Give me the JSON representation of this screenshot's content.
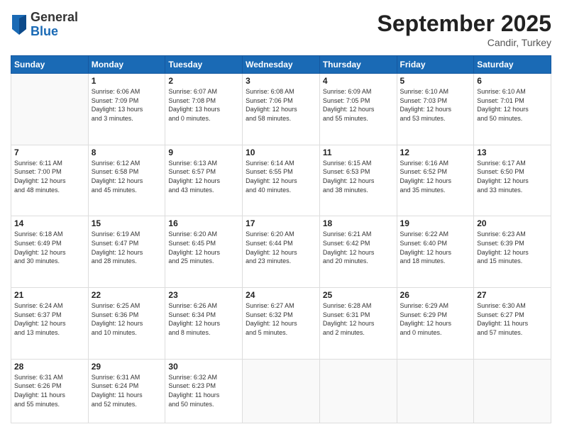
{
  "header": {
    "logo_general": "General",
    "logo_blue": "Blue",
    "month_title": "September 2025",
    "location": "Candir, Turkey"
  },
  "weekdays": [
    "Sunday",
    "Monday",
    "Tuesday",
    "Wednesday",
    "Thursday",
    "Friday",
    "Saturday"
  ],
  "weeks": [
    [
      {
        "day": "",
        "info": ""
      },
      {
        "day": "1",
        "info": "Sunrise: 6:06 AM\nSunset: 7:09 PM\nDaylight: 13 hours\nand 3 minutes."
      },
      {
        "day": "2",
        "info": "Sunrise: 6:07 AM\nSunset: 7:08 PM\nDaylight: 13 hours\nand 0 minutes."
      },
      {
        "day": "3",
        "info": "Sunrise: 6:08 AM\nSunset: 7:06 PM\nDaylight: 12 hours\nand 58 minutes."
      },
      {
        "day": "4",
        "info": "Sunrise: 6:09 AM\nSunset: 7:05 PM\nDaylight: 12 hours\nand 55 minutes."
      },
      {
        "day": "5",
        "info": "Sunrise: 6:10 AM\nSunset: 7:03 PM\nDaylight: 12 hours\nand 53 minutes."
      },
      {
        "day": "6",
        "info": "Sunrise: 6:10 AM\nSunset: 7:01 PM\nDaylight: 12 hours\nand 50 minutes."
      }
    ],
    [
      {
        "day": "7",
        "info": "Sunrise: 6:11 AM\nSunset: 7:00 PM\nDaylight: 12 hours\nand 48 minutes."
      },
      {
        "day": "8",
        "info": "Sunrise: 6:12 AM\nSunset: 6:58 PM\nDaylight: 12 hours\nand 45 minutes."
      },
      {
        "day": "9",
        "info": "Sunrise: 6:13 AM\nSunset: 6:57 PM\nDaylight: 12 hours\nand 43 minutes."
      },
      {
        "day": "10",
        "info": "Sunrise: 6:14 AM\nSunset: 6:55 PM\nDaylight: 12 hours\nand 40 minutes."
      },
      {
        "day": "11",
        "info": "Sunrise: 6:15 AM\nSunset: 6:53 PM\nDaylight: 12 hours\nand 38 minutes."
      },
      {
        "day": "12",
        "info": "Sunrise: 6:16 AM\nSunset: 6:52 PM\nDaylight: 12 hours\nand 35 minutes."
      },
      {
        "day": "13",
        "info": "Sunrise: 6:17 AM\nSunset: 6:50 PM\nDaylight: 12 hours\nand 33 minutes."
      }
    ],
    [
      {
        "day": "14",
        "info": "Sunrise: 6:18 AM\nSunset: 6:49 PM\nDaylight: 12 hours\nand 30 minutes."
      },
      {
        "day": "15",
        "info": "Sunrise: 6:19 AM\nSunset: 6:47 PM\nDaylight: 12 hours\nand 28 minutes."
      },
      {
        "day": "16",
        "info": "Sunrise: 6:20 AM\nSunset: 6:45 PM\nDaylight: 12 hours\nand 25 minutes."
      },
      {
        "day": "17",
        "info": "Sunrise: 6:20 AM\nSunset: 6:44 PM\nDaylight: 12 hours\nand 23 minutes."
      },
      {
        "day": "18",
        "info": "Sunrise: 6:21 AM\nSunset: 6:42 PM\nDaylight: 12 hours\nand 20 minutes."
      },
      {
        "day": "19",
        "info": "Sunrise: 6:22 AM\nSunset: 6:40 PM\nDaylight: 12 hours\nand 18 minutes."
      },
      {
        "day": "20",
        "info": "Sunrise: 6:23 AM\nSunset: 6:39 PM\nDaylight: 12 hours\nand 15 minutes."
      }
    ],
    [
      {
        "day": "21",
        "info": "Sunrise: 6:24 AM\nSunset: 6:37 PM\nDaylight: 12 hours\nand 13 minutes."
      },
      {
        "day": "22",
        "info": "Sunrise: 6:25 AM\nSunset: 6:36 PM\nDaylight: 12 hours\nand 10 minutes."
      },
      {
        "day": "23",
        "info": "Sunrise: 6:26 AM\nSunset: 6:34 PM\nDaylight: 12 hours\nand 8 minutes."
      },
      {
        "day": "24",
        "info": "Sunrise: 6:27 AM\nSunset: 6:32 PM\nDaylight: 12 hours\nand 5 minutes."
      },
      {
        "day": "25",
        "info": "Sunrise: 6:28 AM\nSunset: 6:31 PM\nDaylight: 12 hours\nand 2 minutes."
      },
      {
        "day": "26",
        "info": "Sunrise: 6:29 AM\nSunset: 6:29 PM\nDaylight: 12 hours\nand 0 minutes."
      },
      {
        "day": "27",
        "info": "Sunrise: 6:30 AM\nSunset: 6:27 PM\nDaylight: 11 hours\nand 57 minutes."
      }
    ],
    [
      {
        "day": "28",
        "info": "Sunrise: 6:31 AM\nSunset: 6:26 PM\nDaylight: 11 hours\nand 55 minutes."
      },
      {
        "day": "29",
        "info": "Sunrise: 6:31 AM\nSunset: 6:24 PM\nDaylight: 11 hours\nand 52 minutes."
      },
      {
        "day": "30",
        "info": "Sunrise: 6:32 AM\nSunset: 6:23 PM\nDaylight: 11 hours\nand 50 minutes."
      },
      {
        "day": "",
        "info": ""
      },
      {
        "day": "",
        "info": ""
      },
      {
        "day": "",
        "info": ""
      },
      {
        "day": "",
        "info": ""
      }
    ]
  ]
}
